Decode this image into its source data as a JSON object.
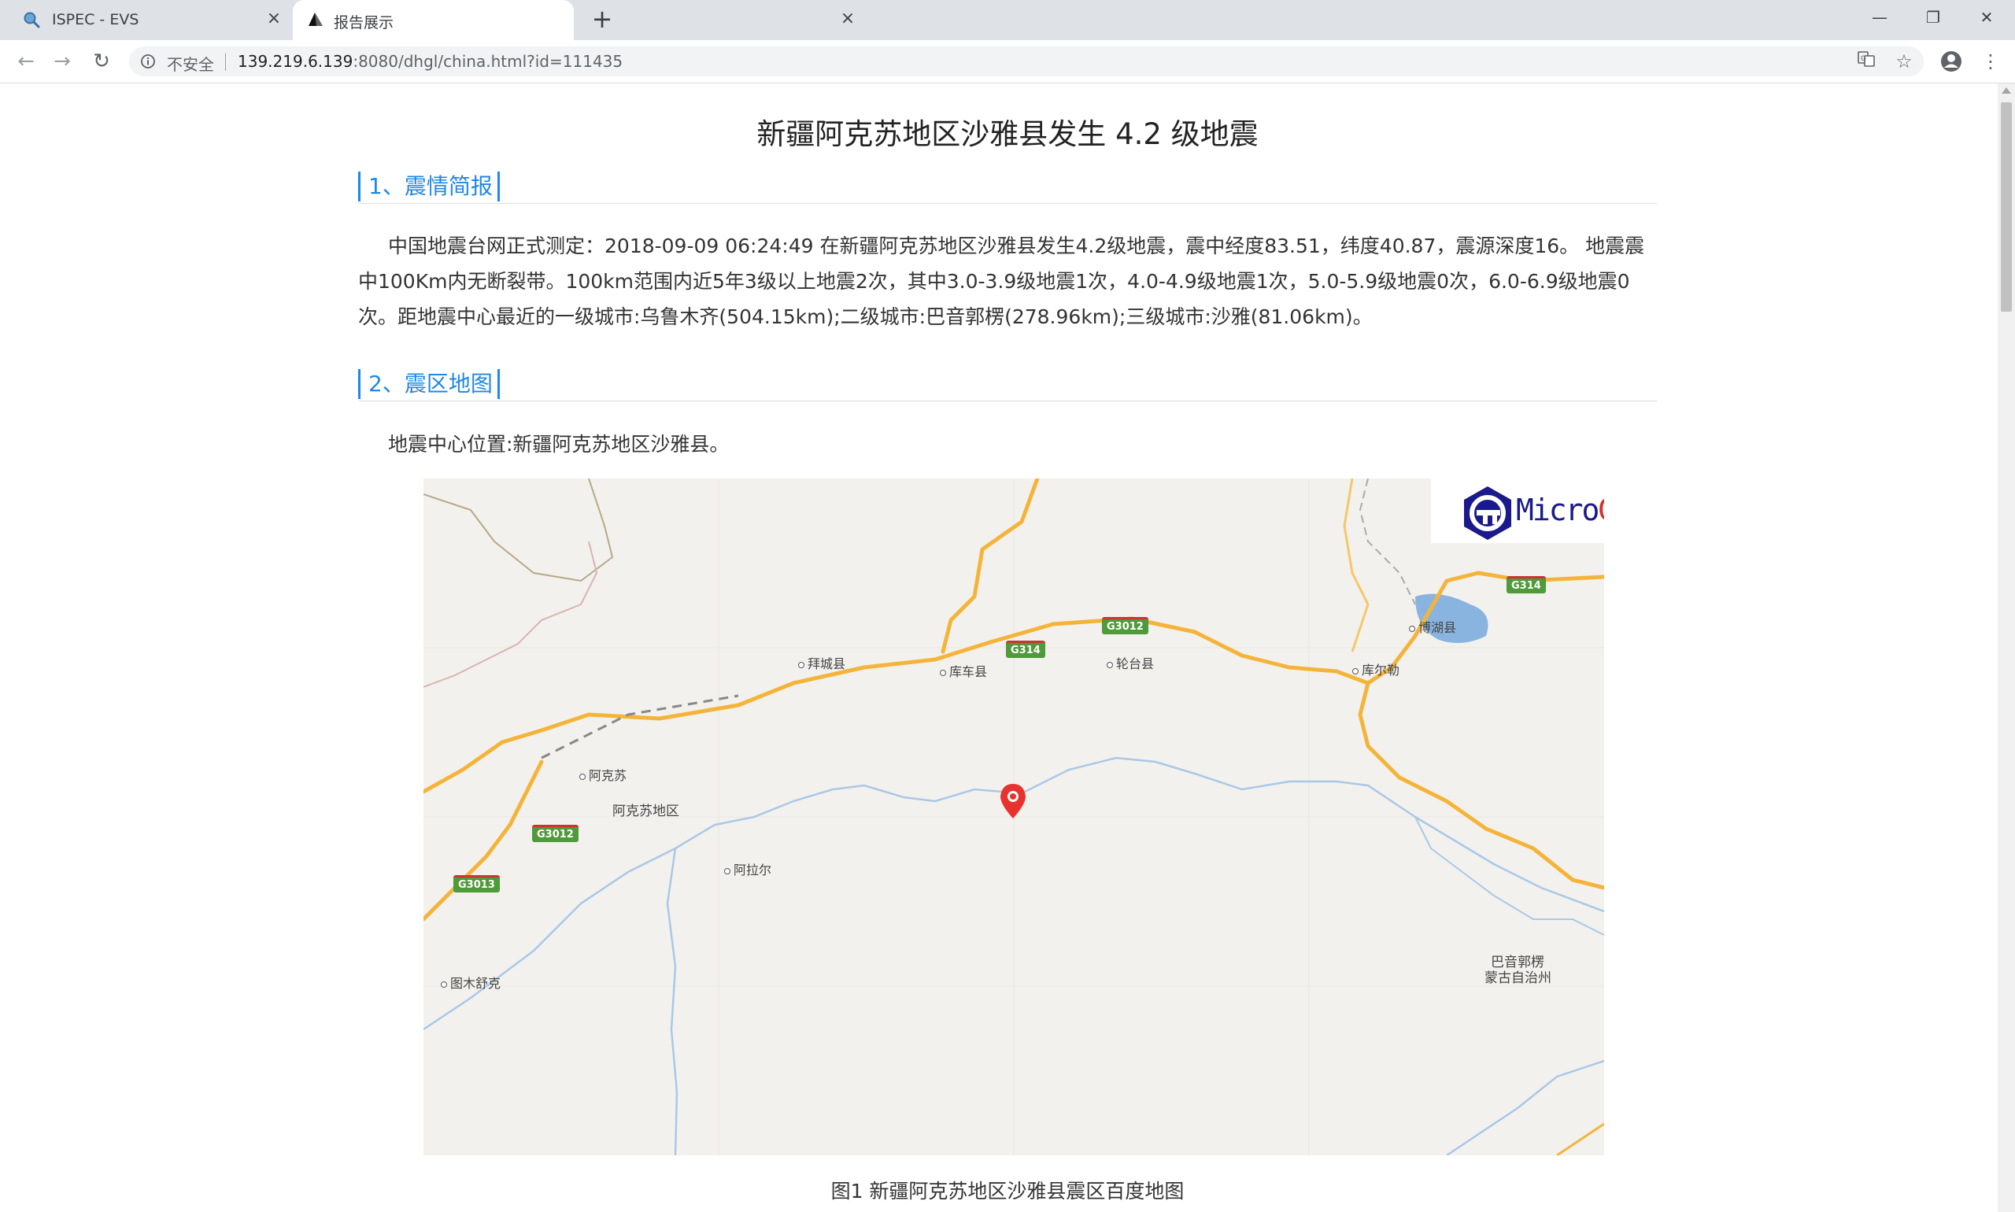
{
  "browser": {
    "tabs": [
      {
        "title": "ISPEC - EVS",
        "icon": "search-icon",
        "active": false
      },
      {
        "title": "报告展示",
        "icon": "sail-icon",
        "active": true
      }
    ],
    "new_tab_label": "+",
    "security_label": "不安全",
    "url_host": "139.219.6.139",
    "url_rest": ":8080/dhgl/china.html?id=111435"
  },
  "report": {
    "title": "新疆阿克苏地区沙雅县发生 4.2 级地震",
    "section1_title": "1、震情简报",
    "section1_text": "中国地震台网正式测定：2018-09-09 06:24:49 在新疆阿克苏地区沙雅县发生4.2级地震，震中经度83.51，纬度40.87，震源深度16。 地震震中100Km内无断裂带。100km范围内近5年3级以上地震2次，其中3.0-3.9级地震1次，4.0-4.9级地震1次，5.0-5.9级地震0次，6.0-6.9级地震0次。距地震中心最近的一级城市:乌鲁木齐(504.15km);二级城市:巴音郭楞(278.96km);三级城市:沙雅(81.06km)。",
    "section2_title": "2、震区地图",
    "section2_text": "地震中心位置:新疆阿克苏地区沙雅县。",
    "figure_caption": "图1 新疆阿克苏地区沙雅县震区百度地图"
  },
  "map": {
    "logo_text_main": "Micro",
    "logo_text_accent": "G",
    "cities": [
      "拜城县",
      "库车县",
      "轮台县",
      "库尔勒",
      "博湖县",
      "阿克苏",
      "阿拉尔",
      "图木舒克"
    ],
    "regions": [
      "阿克苏地区",
      "巴音郭楞",
      "蒙古自治州"
    ],
    "highways": [
      "G3012",
      "G314",
      "G314",
      "G3012",
      "G3013",
      "G314"
    ],
    "colors": {
      "highway": "#f4b43a",
      "river": "#a9c8e8",
      "lake": "#8ab4e0",
      "border": "#b8a888",
      "marker": "#e8322d",
      "shield": "#4f9a3a"
    }
  }
}
